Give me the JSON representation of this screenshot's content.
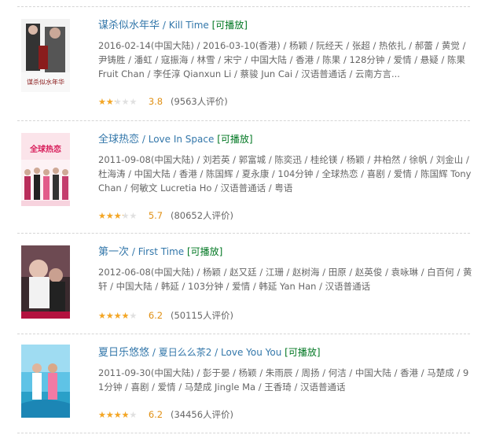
{
  "movies": [
    {
      "title_zh": "谋杀似水年华",
      "sep": "/",
      "title_extra": "Kill Time",
      "playable": "[可播放]",
      "meta": "2016-02-14(中国大陆) / 2016-03-10(香港) / 杨颖 / 阮经天 / 张超 / 热依扎 / 郝蕾 / 黄觉 / 尹铸胜 / 潘虹 / 寇振海 / 林雪 / 宋宁 / 中国大陆 / 香港 / 陈果 / 128分钟 / 爱情 / 悬疑 / 陈果 Fruit Chan / 李任淳 Qianxun Li / 蔡骏 Jun Cai / 汉语普通话 / 云南方言...",
      "score": "3.8",
      "votes": "(9563人评价)",
      "rating_fraction": 0.4
    },
    {
      "title_zh": "全球热恋",
      "sep": "/",
      "title_extra": "Love In Space",
      "playable": "[可播放]",
      "meta": "2011-09-08(中国大陆) / 刘若英 / 郭富城 / 陈奕迅 / 桂纶镁 / 杨颖 / 井柏然 / 徐帆 / 刘金山 / 杜海涛 / 中国大陆 / 香港 / 陈国辉 / 夏永康 / 104分钟 / 全球热恋 / 喜剧 / 爱情 / 陈国辉 Tony Chan / 何敏文 Lucretia Ho / 汉语普通话 / 粤语",
      "score": "5.7",
      "votes": "(80652人评价)",
      "rating_fraction": 0.6
    },
    {
      "title_zh": "第一次",
      "sep": "/",
      "title_extra": "First Time",
      "playable": "[可播放]",
      "meta": "2012-06-08(中国大陆) / 杨颖 / 赵又廷 / 江珊 / 赵树海 / 田原 / 赵英俊 / 袁咏琳 / 白百何 / 黄轩 / 中国大陆 / 韩延 / 103分钟 / 爱情 / 韩延 Yan Han / 汉语普通话",
      "score": "6.2",
      "votes": "(50115人评价)",
      "rating_fraction": 0.7
    },
    {
      "title_zh": "夏日乐悠悠",
      "sep": "/",
      "title_extra": "夏日么么茶2 / Love You You",
      "playable": "[可播放]",
      "meta": "2011-09-30(中国大陆) / 彭于晏 / 杨颖 / 朱雨辰 / 周扬 / 何洁 / 中国大陆 / 香港 / 马楚成 / 91分钟 / 喜剧 / 爱情 / 马楚成 Jingle Ma / 王香琦 / 汉语普通话",
      "score": "6.2",
      "votes": "(34456人评价)",
      "rating_fraction": 0.7
    }
  ],
  "poster_texts": [
    "谋杀似水年华",
    "全球热恋"
  ]
}
